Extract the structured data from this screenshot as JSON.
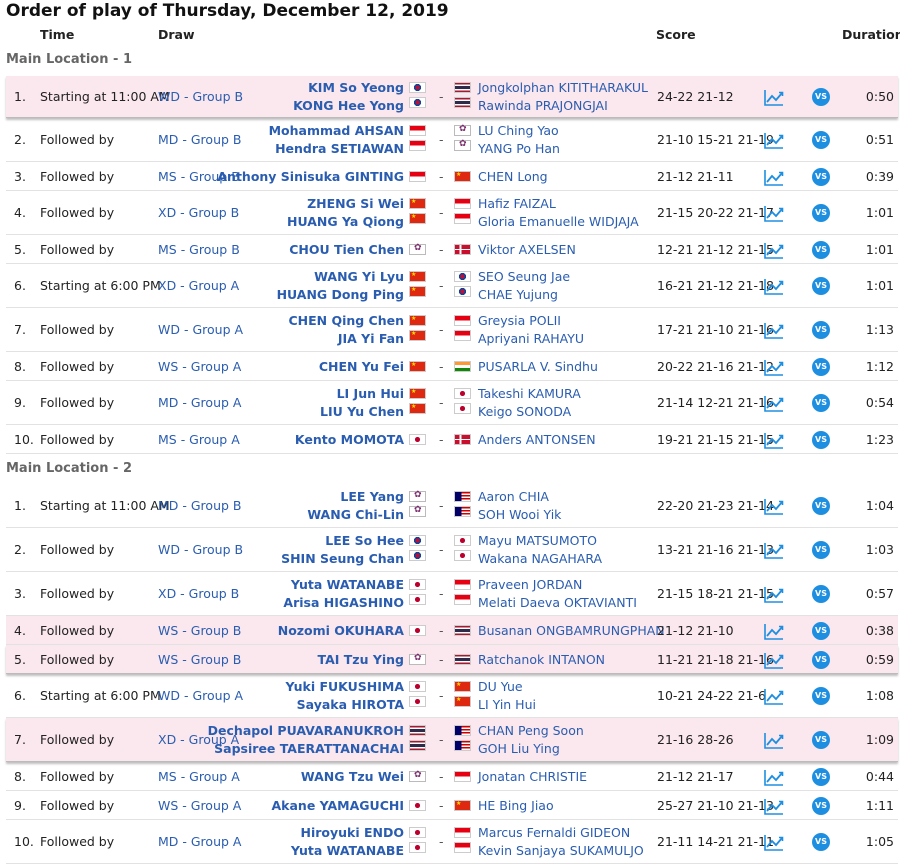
{
  "page": {
    "title": "Order of play of Thursday, December 12, 2019",
    "headers": {
      "time": "Time",
      "draw": "Draw",
      "score": "Score",
      "duration": "Duration"
    }
  },
  "icons": {
    "chart": "stats-chart-icon",
    "vs": "head-to-head-vs-icon",
    "vs_label": "VS",
    "dash": "-"
  },
  "colors": {
    "link": "#2a5db0",
    "highlight": "#fbe7ee",
    "vs_button": "#1e8fe0"
  },
  "sections": [
    {
      "name": "Main Location - 1",
      "matches": [
        {
          "no": "1.",
          "time": "Starting at 11:00 AM",
          "draw": "WD - Group B",
          "team1": [
            "KIM So Yeong",
            "KONG Hee Yong"
          ],
          "flag1": [
            "kr",
            "kr"
          ],
          "team2": [
            "Jongkolphan KITITHARAKUL",
            "Rawinda PRAJONGJAI"
          ],
          "flag2": [
            "th",
            "th"
          ],
          "score": "24-22 21-12",
          "duration": "0:50",
          "highlight": "hl"
        },
        {
          "no": "2.",
          "time": "Followed by",
          "draw": "MD - Group B",
          "team1": [
            "Mohammad AHSAN",
            "Hendra SETIAWAN"
          ],
          "flag1": [
            "id",
            "id"
          ],
          "team2": [
            "LU Ching Yao",
            "YANG Po Han"
          ],
          "flag2": [
            "tpe",
            "tpe"
          ],
          "score": "21-10 15-21 21-19",
          "duration": "0:51"
        },
        {
          "no": "3.",
          "time": "Followed by",
          "draw": "MS - Group B",
          "team1": [
            "Anthony Sinisuka GINTING"
          ],
          "flag1": [
            "id"
          ],
          "team2": [
            "CHEN Long"
          ],
          "flag2": [
            "cn"
          ],
          "score": "21-12 21-11",
          "duration": "0:39"
        },
        {
          "no": "4.",
          "time": "Followed by",
          "draw": "XD - Group B",
          "team1": [
            "ZHENG Si Wei",
            "HUANG Ya Qiong"
          ],
          "flag1": [
            "cn",
            "cn"
          ],
          "team2": [
            "Hafiz FAIZAL",
            "Gloria Emanuelle WIDJAJA"
          ],
          "flag2": [
            "id",
            "id"
          ],
          "score": "21-15 20-22 21-17",
          "duration": "1:01"
        },
        {
          "no": "5.",
          "time": "Followed by",
          "draw": "MS - Group B",
          "team1": [
            "CHOU Tien Chen"
          ],
          "flag1": [
            "tpe"
          ],
          "team2": [
            "Viktor AXELSEN"
          ],
          "flag2": [
            "dk"
          ],
          "score": "12-21 21-12 21-15",
          "duration": "1:01"
        },
        {
          "no": "6.",
          "time": "Starting at 6:00 PM",
          "draw": "XD - Group A",
          "team1": [
            "WANG Yi Lyu",
            "HUANG Dong Ping"
          ],
          "flag1": [
            "cn",
            "cn"
          ],
          "team2": [
            "SEO Seung Jae",
            "CHAE Yujung"
          ],
          "flag2": [
            "kr",
            "kr"
          ],
          "score": "16-21 21-12 21-18",
          "duration": "1:01"
        },
        {
          "no": "7.",
          "time": "Followed by",
          "draw": "WD - Group A",
          "team1": [
            "CHEN Qing Chen",
            "JIA Yi Fan"
          ],
          "flag1": [
            "cn",
            "cn"
          ],
          "team2": [
            "Greysia POLII",
            "Apriyani RAHAYU"
          ],
          "flag2": [
            "id",
            "id"
          ],
          "score": "17-21 21-10 21-16",
          "duration": "1:13"
        },
        {
          "no": "8.",
          "time": "Followed by",
          "draw": "WS - Group A",
          "team1": [
            "CHEN Yu Fei"
          ],
          "flag1": [
            "cn"
          ],
          "team2": [
            "PUSARLA V. Sindhu"
          ],
          "flag2": [
            "in"
          ],
          "score": "20-22 21-16 21-12",
          "duration": "1:12"
        },
        {
          "no": "9.",
          "time": "Followed by",
          "draw": "MD - Group A",
          "team1": [
            "LI Jun Hui",
            "LIU Yu Chen"
          ],
          "flag1": [
            "cn",
            "cn"
          ],
          "team2": [
            "Takeshi KAMURA",
            "Keigo SONODA"
          ],
          "flag2": [
            "jp",
            "jp"
          ],
          "score": "21-14 12-21 21-16",
          "duration": "0:54"
        },
        {
          "no": "10.",
          "time": "Followed by",
          "draw": "MS - Group A",
          "team1": [
            "Kento MOMOTA"
          ],
          "flag1": [
            "jp"
          ],
          "team2": [
            "Anders ANTONSEN"
          ],
          "flag2": [
            "dk"
          ],
          "score": "19-21 21-15 21-15",
          "duration": "1:23"
        }
      ]
    },
    {
      "name": "Main Location - 2",
      "matches": [
        {
          "no": "1.",
          "time": "Starting at 11:00 AM",
          "draw": "MD - Group B",
          "team1": [
            "LEE Yang",
            "WANG Chi-Lin"
          ],
          "flag1": [
            "tpe",
            "tpe"
          ],
          "team2": [
            "Aaron CHIA",
            "SOH Wooi Yik"
          ],
          "flag2": [
            "my",
            "my"
          ],
          "score": "22-20 21-23 21-14",
          "duration": "1:04"
        },
        {
          "no": "2.",
          "time": "Followed by",
          "draw": "WD - Group B",
          "team1": [
            "LEE So Hee",
            "SHIN Seung Chan"
          ],
          "flag1": [
            "kr",
            "kr"
          ],
          "team2": [
            "Mayu MATSUMOTO",
            "Wakana NAGAHARA"
          ],
          "flag2": [
            "jp",
            "jp"
          ],
          "score": "13-21 21-16 21-13",
          "duration": "1:03"
        },
        {
          "no": "3.",
          "time": "Followed by",
          "draw": "XD - Group B",
          "team1": [
            "Yuta WATANABE",
            "Arisa HIGASHINO"
          ],
          "flag1": [
            "jp",
            "jp"
          ],
          "team2": [
            "Praveen JORDAN",
            "Melati Daeva OKTAVIANTI"
          ],
          "flag2": [
            "id",
            "id"
          ],
          "score": "21-15 18-21 21-15",
          "duration": "0:57"
        },
        {
          "no": "4.",
          "time": "Followed by",
          "draw": "WS - Group B",
          "team1": [
            "Nozomi OKUHARA"
          ],
          "flag1": [
            "jp"
          ],
          "team2": [
            "Busanan ONGBAMRUNGPHAN"
          ],
          "flag2": [
            "th"
          ],
          "score": "21-12 21-10",
          "duration": "0:38",
          "highlight": "hl2"
        },
        {
          "no": "5.",
          "time": "Followed by",
          "draw": "WS - Group B",
          "team1": [
            "TAI Tzu Ying"
          ],
          "flag1": [
            "tpe"
          ],
          "team2": [
            "Ratchanok INTANON"
          ],
          "flag2": [
            "th"
          ],
          "score": "11-21 21-18 21-16",
          "duration": "0:59",
          "highlight": "hl"
        },
        {
          "no": "6.",
          "time": "Starting at 6:00 PM",
          "draw": "WD - Group A",
          "team1": [
            "Yuki FUKUSHIMA",
            "Sayaka HIROTA"
          ],
          "flag1": [
            "jp",
            "jp"
          ],
          "team2": [
            "DU Yue",
            "LI Yin Hui"
          ],
          "flag2": [
            "cn",
            "cn"
          ],
          "score": "10-21 24-22 21-6",
          "duration": "1:08"
        },
        {
          "no": "7.",
          "time": "Followed by",
          "draw": "XD - Group A",
          "team1": [
            "Dechapol PUAVARANUKROH",
            "Sapsiree TAERATTANACHAI"
          ],
          "flag1": [
            "th",
            "th"
          ],
          "team2": [
            "CHAN Peng Soon",
            "GOH Liu Ying"
          ],
          "flag2": [
            "my",
            "my"
          ],
          "score": "21-16 28-26",
          "duration": "1:09",
          "highlight": "hl"
        },
        {
          "no": "8.",
          "time": "Followed by",
          "draw": "MS - Group A",
          "team1": [
            "WANG Tzu Wei"
          ],
          "flag1": [
            "tpe"
          ],
          "team2": [
            "Jonatan CHRISTIE"
          ],
          "flag2": [
            "id"
          ],
          "score": "21-12 21-17",
          "duration": "0:44"
        },
        {
          "no": "9.",
          "time": "Followed by",
          "draw": "WS - Group A",
          "team1": [
            "Akane YAMAGUCHI"
          ],
          "flag1": [
            "jp"
          ],
          "team2": [
            "HE Bing Jiao"
          ],
          "flag2": [
            "cn"
          ],
          "score": "25-27 21-10 21-13",
          "duration": "1:11"
        },
        {
          "no": "10.",
          "time": "Followed by",
          "draw": "MD - Group A",
          "team1": [
            "Hiroyuki ENDO",
            "Yuta WATANABE"
          ],
          "flag1": [
            "jp",
            "jp"
          ],
          "team2": [
            "Marcus Fernaldi GIDEON",
            "Kevin Sanjaya SUKAMULJO"
          ],
          "flag2": [
            "id",
            "id"
          ],
          "score": "21-11 14-21 21-11",
          "duration": "1:05"
        }
      ]
    }
  ]
}
